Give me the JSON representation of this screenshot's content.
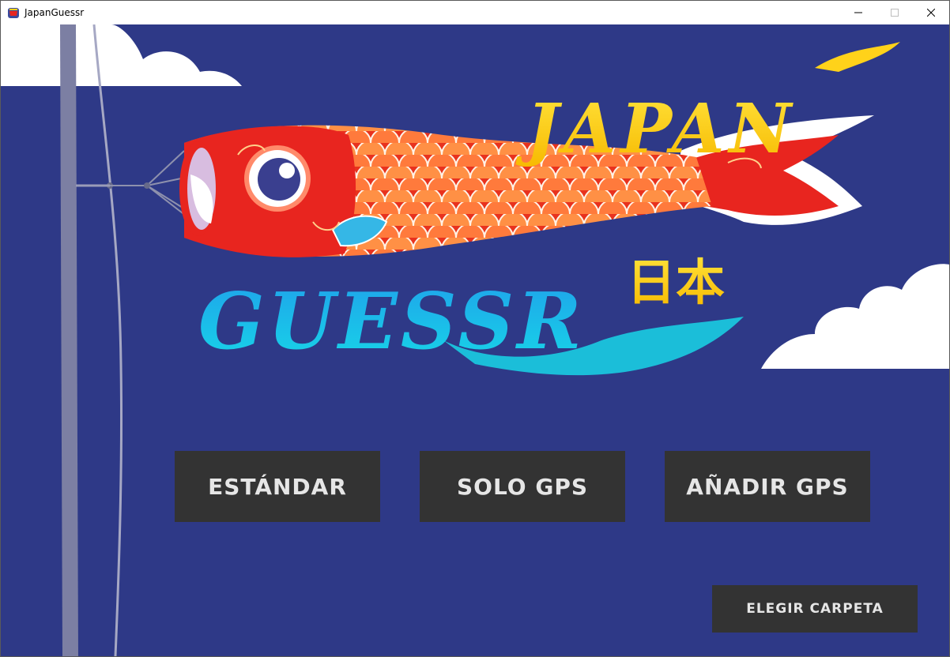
{
  "window": {
    "title": "JapanGuessr",
    "controls": {
      "minimize_glyph": "—",
      "maximize_glyph": "☐",
      "close_glyph": "✕"
    }
  },
  "logo": {
    "word_top": "JAPAN",
    "word_bottom": "GUESSR",
    "kanji": "日本"
  },
  "menu": {
    "buttons": [
      {
        "label": "ESTÁNDAR"
      },
      {
        "label": "SOLO GPS"
      },
      {
        "label": "AÑADIR GPS"
      }
    ],
    "folder_button": "ELEGIR CARPETA"
  },
  "colors": {
    "background": "#2e3987",
    "button_bg": "#333333",
    "button_text": "#e6e6e6",
    "koi_red": "#e8251f",
    "logo_yellow": "#ffd21a",
    "logo_cyan": "#14c8e6"
  }
}
